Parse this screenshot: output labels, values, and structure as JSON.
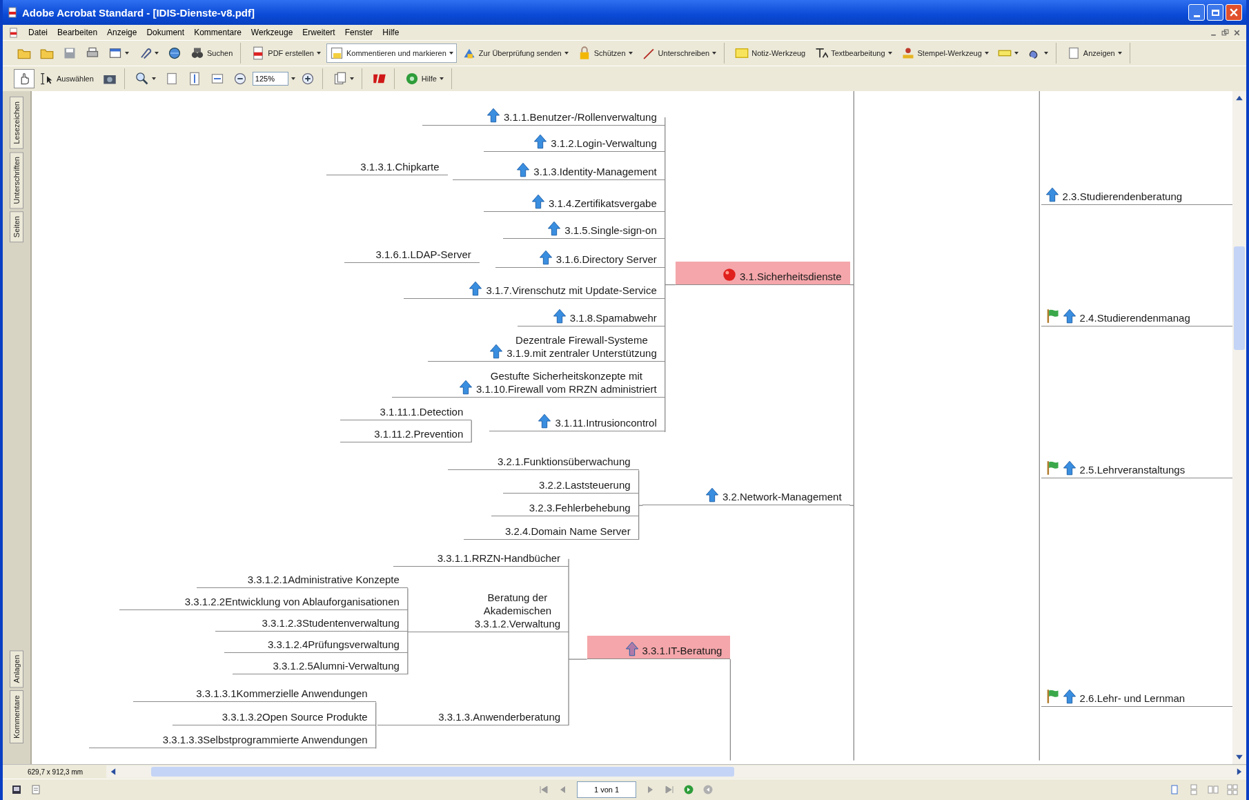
{
  "window": {
    "title": "Adobe Acrobat Standard - [IDIS-Dienste-v8.pdf]"
  },
  "menu": [
    "Datei",
    "Bearbeiten",
    "Anzeige",
    "Dokument",
    "Kommentare",
    "Werkzeuge",
    "Erweitert",
    "Fenster",
    "Hilfe"
  ],
  "toolbar_1": [
    [
      {
        "dropdown": false
      },
      {
        "dropdown": false
      },
      {
        "dropdown": false
      },
      {
        "dropdown": false
      },
      {
        "dropdown": true
      },
      {
        "dropdown": true
      },
      {
        "dropdown": false
      },
      {
        "label": "Suchen",
        "dropdown": false
      }
    ],
    [
      {
        "label": "PDF erstellen",
        "dropdown": true
      },
      {
        "label": "Kommentieren und markieren",
        "dropdown": true
      },
      {
        "label": "Zur Überprüfung senden",
        "dropdown": true
      },
      {
        "label": "Schützen",
        "dropdown": true
      },
      {
        "label": "Unterschreiben",
        "dropdown": true
      }
    ],
    [
      {
        "label": "Notiz-Werkzeug",
        "dropdown": false
      },
      {
        "label": "Textbearbeitung",
        "dropdown": true
      },
      {
        "label": "Stempel-Werkzeug",
        "dropdown": true
      },
      {
        "dropdown": true
      },
      {
        "dropdown": true
      }
    ],
    [
      {
        "label": "Anzeigen",
        "dropdown": true
      }
    ]
  ],
  "toolbar_2": [
    [
      {
        "kind": "button",
        "dropdown": false,
        "selected": true
      },
      {
        "kind": "button",
        "label": "Auswählen",
        "dropdown": false,
        "selected": false
      },
      {
        "kind": "button",
        "dropdown": false,
        "selected": false
      }
    ],
    [
      {
        "kind": "button",
        "dropdown": true
      },
      {
        "kind": "button",
        "dropdown": false
      },
      {
        "kind": "button",
        "dropdown": false
      },
      {
        "kind": "button",
        "dropdown": false
      },
      {
        "kind": "button",
        "dropdown": false
      },
      {
        "kind": "field",
        "value": "125%",
        "dropdown": true
      },
      {
        "kind": "button",
        "dropdown": false
      }
    ],
    [
      {
        "kind": "button",
        "dropdown": true
      }
    ],
    [
      {
        "kind": "button",
        "dropdown": false
      }
    ],
    [
      {
        "kind": "button",
        "label": "Hilfe",
        "dropdown": true
      }
    ]
  ],
  "side_tabs_top": [
    "Lesezeichen",
    "Unterschriften",
    "Seiten"
  ],
  "side_tabs_bottom": [
    "Anlagen",
    "Kommentare"
  ],
  "mindmap": [
    {
      "lines": [
        "3.1.1.Benutzer-/Rollenverwaltung"
      ],
      "kind": "arrow",
      "highlighted": false
    },
    {
      "lines": [
        "3.1.2.Login-Verwaltung"
      ],
      "kind": "arrow",
      "highlighted": false
    },
    {
      "lines": [
        "3.1.3.1.Chipkarte"
      ],
      "kind": "plain",
      "highlighted": false
    },
    {
      "lines": [
        "3.1.3.Identity-Management"
      ],
      "kind": "arrow",
      "highlighted": false
    },
    {
      "lines": [
        "3.1.4.Zertifikatsvergabe"
      ],
      "kind": "arrow",
      "highlighted": false
    },
    {
      "lines": [
        "3.1.5.Single-sign-on"
      ],
      "kind": "arrow",
      "highlighted": false
    },
    {
      "lines": [
        "3.1.6.1.LDAP-Server"
      ],
      "kind": "plain",
      "highlighted": false
    },
    {
      "lines": [
        "3.1.6.Directory Server"
      ],
      "kind": "arrow",
      "highlighted": false
    },
    {
      "lines": [
        "3.1.Sicherheitsdienste"
      ],
      "kind": "ball",
      "highlighted": true
    },
    {
      "lines": [
        "3.1.7.Virenschutz mit Update-Service"
      ],
      "kind": "arrow",
      "highlighted": false
    },
    {
      "lines": [
        "3.1.8.Spamabwehr"
      ],
      "kind": "arrow",
      "highlighted": false
    },
    {
      "lines": [
        "Dezentrale Firewall-Systeme",
        "3.1.9.mit zentraler Unterstützung"
      ],
      "kind": "arrow",
      "highlighted": false
    },
    {
      "lines": [
        "Gestufte Sicherheitskonzepte mit",
        "3.1.10.Firewall vom RRZN administriert"
      ],
      "kind": "arrow",
      "highlighted": false
    },
    {
      "lines": [
        "3.1.11.1.Detection"
      ],
      "kind": "plain",
      "highlighted": false
    },
    {
      "lines": [
        "3.1.11.2.Prevention"
      ],
      "kind": "plain",
      "highlighted": false
    },
    {
      "lines": [
        "3.1.11.Intrusioncontrol"
      ],
      "kind": "arrow",
      "highlighted": false
    },
    {
      "lines": [
        "3.2.1.Funktionsüberwachung"
      ],
      "kind": "plain",
      "highlighted": false
    },
    {
      "lines": [
        "3.2.2.Laststeuerung"
      ],
      "kind": "plain",
      "highlighted": false
    },
    {
      "lines": [
        "3.2.3.Fehlerbehebung"
      ],
      "kind": "plain",
      "highlighted": false
    },
    {
      "lines": [
        "3.2.4.Domain Name Server"
      ],
      "kind": "plain",
      "highlighted": false
    },
    {
      "lines": [
        "3.2.Network-Management"
      ],
      "kind": "arrow",
      "highlighted": false
    },
    {
      "lines": [
        "3.3.1.1.RRZN-Handbücher"
      ],
      "kind": "plain",
      "highlighted": false
    },
    {
      "lines": [
        "3.3.1.2.1Administrative Konzepte"
      ],
      "kind": "plain",
      "highlighted": false
    },
    {
      "lines": [
        "3.3.1.2.2Entwicklung von Ablauforganisationen"
      ],
      "kind": "plain",
      "highlighted": false
    },
    {
      "lines": [
        "3.3.1.2.3Studentenverwaltung"
      ],
      "kind": "plain",
      "highlighted": false
    },
    {
      "lines": [
        "3.3.1.2.4Prüfungsverwaltung"
      ],
      "kind": "plain",
      "highlighted": false
    },
    {
      "lines": [
        "3.3.1.2.5Alumni-Verwaltung"
      ],
      "kind": "plain",
      "highlighted": false
    },
    {
      "lines": [
        "Beratung der",
        "Akademischen",
        "3.3.1.2.Verwaltung"
      ],
      "kind": "plain",
      "highlighted": false
    },
    {
      "lines": [
        "3.3.1.IT-Beratung"
      ],
      "kind": "arrow",
      "highlighted": true
    },
    {
      "lines": [
        "3.3.1.3.1Kommerzielle Anwendungen"
      ],
      "kind": "plain",
      "highlighted": false
    },
    {
      "lines": [
        "3.3.1.3.2Open Source Produkte"
      ],
      "kind": "plain",
      "highlighted": false
    },
    {
      "lines": [
        "3.3.1.3.3Selbstprogrammierte Anwendungen"
      ],
      "kind": "plain",
      "highlighted": false
    },
    {
      "lines": [
        "3.3.1.3.Anwenderberatung"
      ],
      "kind": "plain",
      "highlighted": false
    },
    {
      "lines": [
        "2.3.Studierendenberatung"
      ],
      "kind": "arrow",
      "highlighted": false
    },
    {
      "lines": [
        "2.4.Studierendenmanag"
      ],
      "kind": "flag-arrow",
      "highlighted": false
    },
    {
      "lines": [
        "2.5.Lehrveranstaltungs"
      ],
      "kind": "flag-arrow",
      "highlighted": false
    },
    {
      "lines": [
        "2.6.Lehr- und Lernman"
      ],
      "kind": "flag-arrow",
      "highlighted": false
    }
  ],
  "page_size": "629,7 x 912,3 mm",
  "page_field": {
    "value": "1 von 1"
  }
}
